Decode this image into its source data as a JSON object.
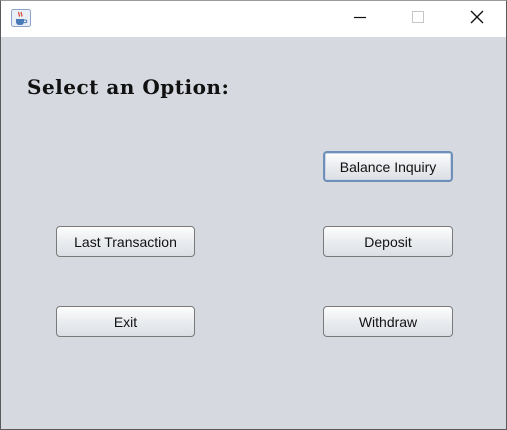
{
  "window": {
    "controls": {
      "minimize": "minimize-icon",
      "maximize": "maximize-icon",
      "close": "close-icon"
    },
    "icon": "java-coffee-cup-icon"
  },
  "main": {
    "heading": "Select an Option:",
    "buttons": {
      "balance_inquiry": "Balance Inquiry",
      "last_transaction": "Last Transaction",
      "deposit": "Deposit",
      "exit": "Exit",
      "withdraw": "Withdraw"
    }
  },
  "colors": {
    "content_bg": "#d6d9e0",
    "titlebar_bg": "#ffffff",
    "focus_border": "#6f8fb8"
  }
}
